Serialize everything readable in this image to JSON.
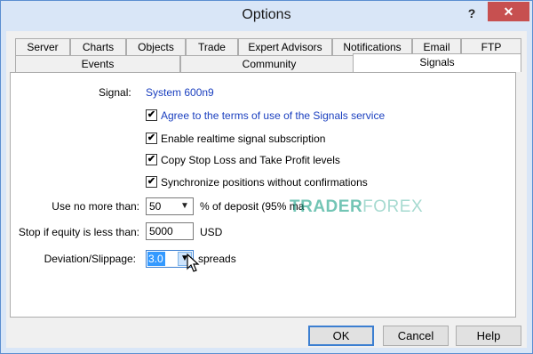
{
  "window": {
    "title": "Options",
    "help_glyph": "?",
    "close_glyph": "✕"
  },
  "tabs_row1": [
    "Server",
    "Charts",
    "Objects",
    "Trade",
    "Expert Advisors",
    "Notifications",
    "Email",
    "FTP"
  ],
  "tabs_row2": [
    "Events",
    "Community",
    "Signals"
  ],
  "active_tab": "Signals",
  "signals": {
    "signal_label": "Signal:",
    "signal_value": "System 600n9",
    "checkboxes": [
      {
        "label": "Agree to the terms of use of the Signals service",
        "checked": true
      },
      {
        "label": "Enable realtime signal subscription",
        "checked": true
      },
      {
        "label": "Copy Stop Loss and Take Profit levels",
        "checked": true
      },
      {
        "label": "Synchronize positions without confirmations",
        "checked": true
      }
    ],
    "use_no_more_label": "Use no more than:",
    "use_no_more_value": "50",
    "use_no_more_suffix": "% of deposit (95% ma",
    "stop_if_label": "Stop if equity is less than:",
    "stop_if_value": "5000",
    "stop_if_suffix": "USD",
    "deviation_label": "Deviation/Slippage:",
    "deviation_value": "3.0",
    "deviation_suffix": "spreads"
  },
  "watermark": {
    "part1": "TRADER",
    "part2": "FOREX"
  },
  "buttons": {
    "ok": "OK",
    "cancel": "Cancel",
    "help": "Help"
  },
  "colors": {
    "link_blue": "#1a3fbf",
    "accent": "#3c7fd1",
    "selection": "#3399ff"
  },
  "icons": {
    "combo_arrow": "chevron-down-icon",
    "check": "checkmark-icon",
    "pointer": "mouse-pointer-icon"
  }
}
